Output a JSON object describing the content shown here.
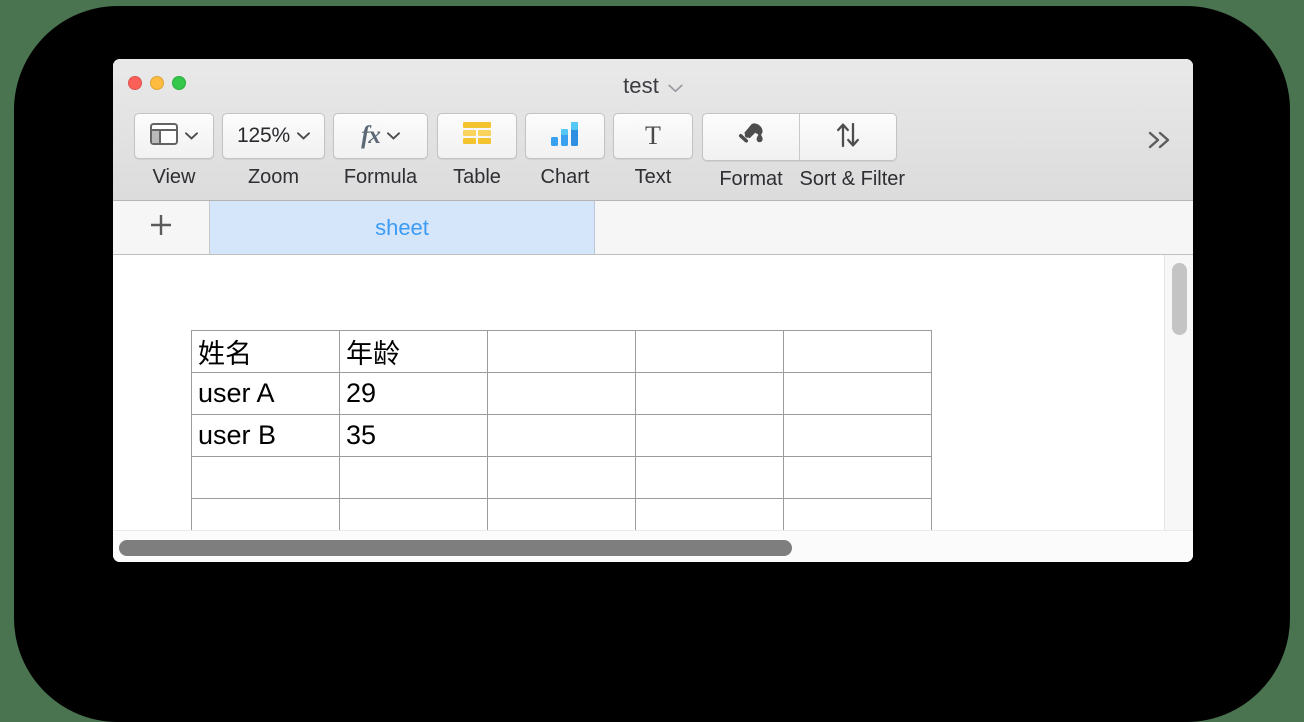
{
  "window": {
    "title": "test",
    "title_chevron_icon": "chevron-down-icon",
    "traffic_lights": [
      {
        "name": "close",
        "color": "#fc6058"
      },
      {
        "name": "minimize",
        "color": "#fdbc40"
      },
      {
        "name": "zoom",
        "color": "#34c749"
      }
    ]
  },
  "toolbar": {
    "view": {
      "label": "View",
      "icon": "window-layout-icon",
      "chevron": "chevron-down-icon"
    },
    "zoom": {
      "label": "Zoom",
      "value": "125%",
      "chevron": "chevron-down-icon"
    },
    "formula": {
      "label": "Formula",
      "icon": "fx-icon",
      "glyph": "fx",
      "chevron": "chevron-down-icon"
    },
    "table": {
      "label": "Table",
      "icon": "table-grid-icon",
      "color": "#f5c33b"
    },
    "chart": {
      "label": "Chart",
      "icon": "bar-chart-icon",
      "color": "#2f9bf0"
    },
    "text": {
      "label": "Text",
      "icon": "text-t-icon",
      "glyph": "T"
    },
    "format": {
      "label": "Format",
      "icon": "paint-brush-icon"
    },
    "sort_filter": {
      "label": "Sort & Filter",
      "icon": "sort-arrows-icon"
    },
    "overflow": {
      "label": "≫",
      "icon": "chevron-double-right-icon"
    }
  },
  "tabbar": {
    "add_label": "+",
    "add_icon": "plus-icon",
    "tabs": [
      {
        "label": "sheet",
        "active": true
      }
    ]
  },
  "spreadsheet": {
    "columns": 5,
    "rows": [
      [
        "姓名",
        "年龄",
        "",
        "",
        ""
      ],
      [
        "user A",
        "29",
        "",
        "",
        ""
      ],
      [
        "user B",
        "35",
        "",
        "",
        ""
      ],
      [
        "",
        "",
        "",
        "",
        ""
      ],
      [
        "",
        "",
        "",
        "",
        ""
      ]
    ]
  },
  "scrollbars": {
    "vertical": {
      "thumb_position": "top"
    },
    "horizontal": {
      "thumb_position": "left"
    }
  },
  "colors": {
    "desktop_background": "#4a7350",
    "backdrop": "#000000",
    "tab_active_bg": "#d6e6fa",
    "tab_active_text": "#3c9bf5"
  }
}
